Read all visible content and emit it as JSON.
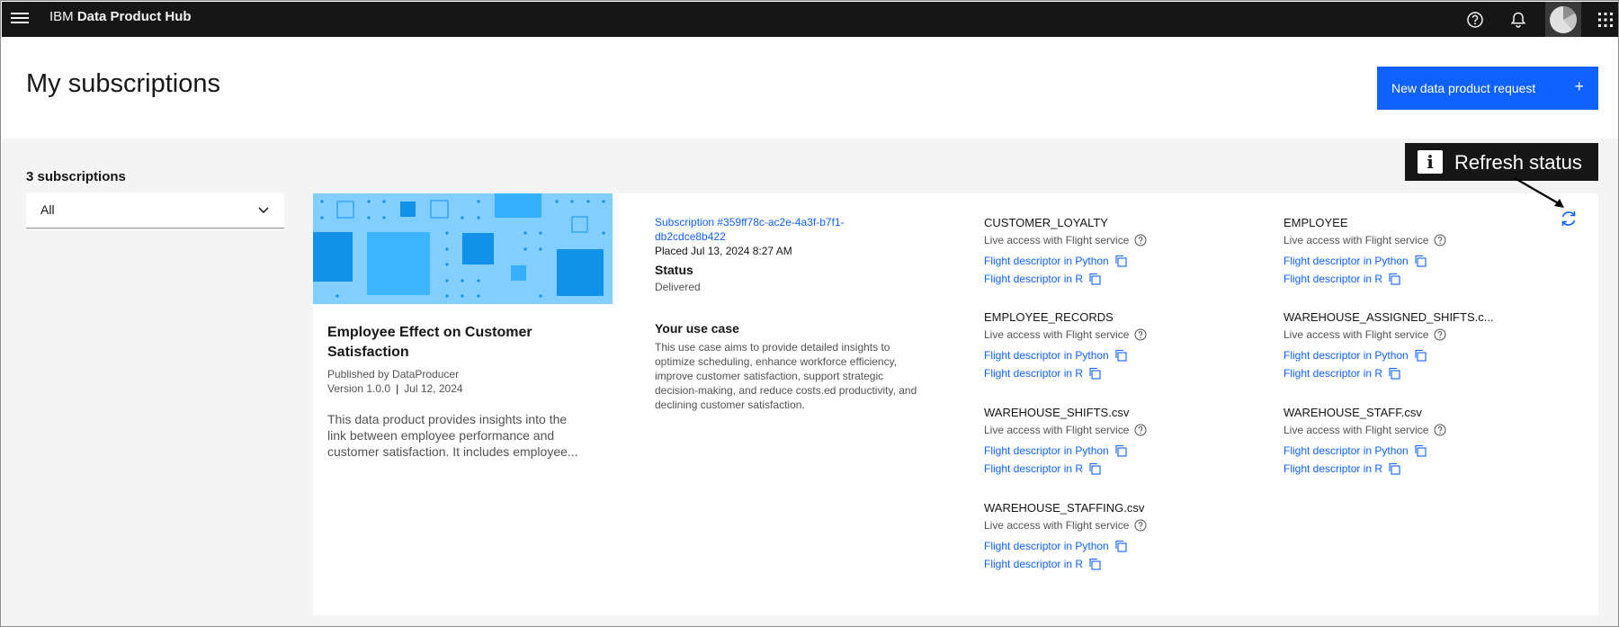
{
  "app": {
    "brand_prefix": "IBM",
    "brand_name": "Data Product Hub"
  },
  "header": {
    "title": "My subscriptions",
    "new_request_label": "New data product request",
    "new_request_icon": "plus-icon"
  },
  "sidebar": {
    "count_label": "3 subscriptions",
    "filter_value": "All"
  },
  "product": {
    "title": "Employee Effect on Customer Satisfaction",
    "publisher": "Published by DataProducer",
    "version": "Version 1.0.0",
    "date": "Jul 12, 2024",
    "description": "This data product provides insights into the link between employee performance and customer satisfaction. It includes employee..."
  },
  "subscription": {
    "id": "Subscription #359ff78c-ac2e-4a3f-b7f1-db2cdce8b422",
    "placed": "Placed Jul 13, 2024 8:27 AM",
    "status_label": "Status",
    "status_value": "Delivered",
    "usecase_label": "Your use case",
    "usecase_text": "This use case aims to provide detailed insights to optimize scheduling, enhance workforce efficiency, improve customer satisfaction, support strategic decision-making, and reduce costs.ed productivity, and declining customer satisfaction."
  },
  "assets": [
    {
      "name": "CUSTOMER_LOYALTY",
      "live": "Live access with Flight service",
      "python": "Flight descriptor in Python",
      "r": "Flight descriptor in R"
    },
    {
      "name": "EMPLOYEE",
      "live": "Live access with Flight service",
      "python": "Flight descriptor in Python",
      "r": "Flight descriptor in R"
    },
    {
      "name": "EMPLOYEE_RECORDS",
      "live": "Live access with Flight service",
      "python": "Flight descriptor in Python",
      "r": "Flight descriptor in R"
    },
    {
      "name": "WAREHOUSE_ASSIGNED_SHIFTS.c...",
      "live": "Live access with Flight service",
      "python": "Flight descriptor in Python",
      "r": "Flight descriptor in R"
    },
    {
      "name": "WAREHOUSE_SHIFTS.csv",
      "live": "Live access with Flight service",
      "python": "Flight descriptor in Python",
      "r": "Flight descriptor in R"
    },
    {
      "name": "WAREHOUSE_STAFF.csv",
      "live": "Live access with Flight service",
      "python": "Flight descriptor in Python",
      "r": "Flight descriptor in R"
    },
    {
      "name": "WAREHOUSE_STAFFING.csv",
      "live": "Live access with Flight service",
      "python": "Flight descriptor in Python",
      "r": "Flight descriptor in R"
    }
  ],
  "tooltip": {
    "text": "Refresh status",
    "icon_letter": "i"
  },
  "colors": {
    "topbar": "#161616",
    "primary": "#0f62fe",
    "banner": "#82cfff",
    "page_bg": "#f4f4f4"
  },
  "icons": [
    "menu-icon",
    "help-icon",
    "notification-icon",
    "avatar",
    "app-switcher-icon",
    "chevron-down-icon",
    "copy-icon",
    "refresh-icon"
  ]
}
